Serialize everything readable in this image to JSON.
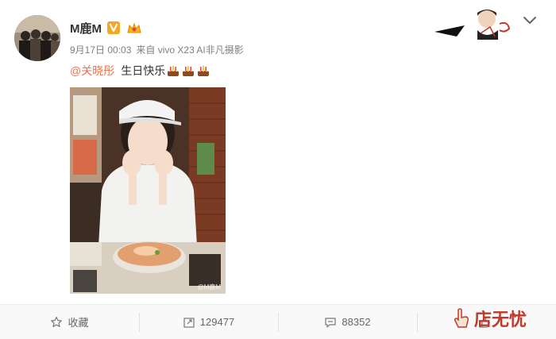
{
  "post": {
    "username": "M鹿M",
    "date": "9月17日 00:03",
    "source": "来自 vivo X23 AI非凡摄影",
    "mention": "@关晓彤",
    "text": "生日快乐",
    "photo_watermark": "@M鹿M"
  },
  "icons": {
    "verified": "orange-v-badge-icon",
    "member": "gold-crown-member-icon",
    "cake": "birthday-cake-icon",
    "more": "chevron-down-icon"
  },
  "actions": {
    "favorite_label": "收藏",
    "repost_count": "129477",
    "comment_count": "88352",
    "like_count": ""
  },
  "site_watermark": {
    "text": "店无忧"
  },
  "colors": {
    "mention": "#eb7350",
    "verified_badge": "#f5a623",
    "meta_text": "#808080",
    "footer_bg": "#f9f9f9",
    "watermark_red": "#c0392b"
  }
}
